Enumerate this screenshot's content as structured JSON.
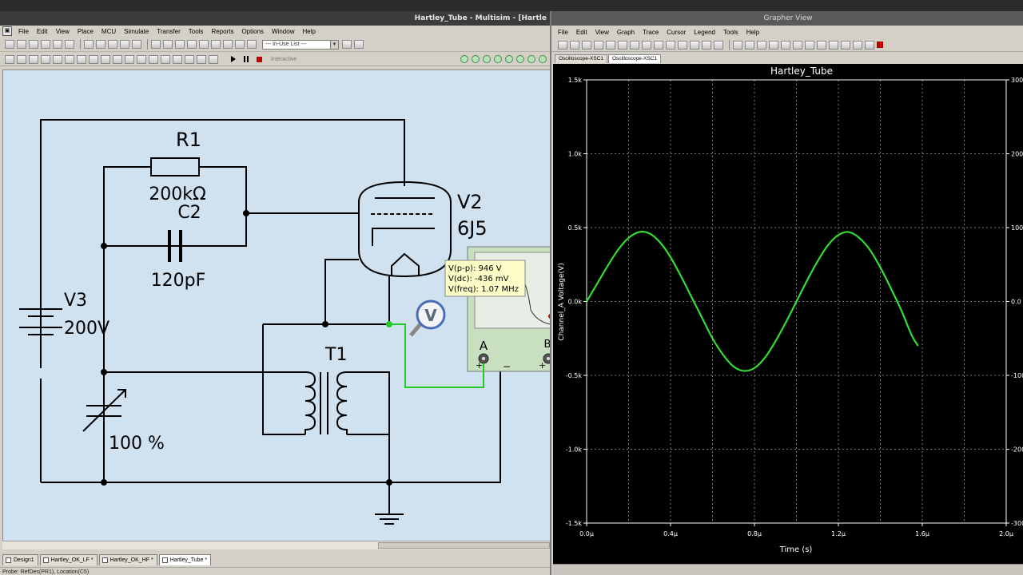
{
  "multisim": {
    "title": "Hartley_Tube - Multisim - [Hartle",
    "app_icon": "multisim-icon",
    "menu": [
      "File",
      "Edit",
      "View",
      "Place",
      "MCU",
      "Simulate",
      "Transfer",
      "Tools",
      "Reports",
      "Options",
      "Window",
      "Help"
    ],
    "in_use_list": "--- In-Use List ---",
    "interactive_label": "Interactive",
    "circuit": {
      "r1_name": "R1",
      "r1_value": "200kΩ",
      "c2_name": "C2",
      "c2_value": "120pF",
      "v2_name": "V2",
      "v2_model": "6J5",
      "v3_name": "V3",
      "v3_value": "200V",
      "t1_name": "T1",
      "pot_value": "100 %",
      "probe_label": "V",
      "scope_a": "A",
      "scope_b": "B",
      "plus": "+",
      "minus": "−",
      "probe_readout": {
        "vpp": "V(p-p):  946 V",
        "vdc": "V(dc):  -436 mV",
        "vfreq": "V(freq):  1.07 MHz"
      }
    },
    "tabs": [
      "Design1",
      "Hartley_OK_LF *",
      "Hartley_OK_HF *",
      "Hartley_Tube *"
    ],
    "active_tab": "Hartley_Tube *",
    "status": "Probe: RefDes(PR1), Location(C5)"
  },
  "grapher": {
    "title": "Grapher View",
    "menu": [
      "File",
      "Edit",
      "View",
      "Graph",
      "Trace",
      "Cursor",
      "Legend",
      "Tools",
      "Help"
    ],
    "tabs": [
      "Oscilloscope-XSC1",
      "Oscilloscope-XSC1"
    ],
    "active_tab_index": 1,
    "trace_color": "#33dd33",
    "chart_data": {
      "type": "line",
      "title": "Hartley_Tube",
      "xlabel": "Time (s)",
      "ylabel": "Channel_A Voltage(V)",
      "xlim": [
        0,
        2.0
      ],
      "ylim": [
        -1.5,
        1.5
      ],
      "x_ticks": [
        "0.0μ",
        "0.4μ",
        "0.8μ",
        "1.2μ",
        "1.6μ",
        "2.0μ"
      ],
      "y_ticks": [
        "1.5k",
        "1.0k",
        "0.5k",
        "0.0k",
        "-0.5k",
        "-1.0k",
        "-1.5k"
      ],
      "y2_ticks": [
        "300",
        "200",
        "100",
        "0.0",
        "-100",
        "-200",
        "-300"
      ],
      "grid": true,
      "series": [
        {
          "x": [
            0.0,
            0.05,
            0.1,
            0.15,
            0.2,
            0.25,
            0.3,
            0.35,
            0.4,
            0.45,
            0.5,
            0.55,
            0.6,
            0.65,
            0.7,
            0.75,
            0.8,
            0.85,
            0.9,
            0.95,
            1.0,
            1.05,
            1.1,
            1.15,
            1.2,
            1.25,
            1.3,
            1.35,
            1.4,
            1.45,
            1.5,
            1.55,
            1.58
          ],
          "y": [
            0.0,
            0.12,
            0.24,
            0.35,
            0.43,
            0.47,
            0.46,
            0.4,
            0.3,
            0.17,
            0.03,
            -0.11,
            -0.25,
            -0.36,
            -0.44,
            -0.47,
            -0.45,
            -0.38,
            -0.27,
            -0.14,
            0.0,
            0.14,
            0.27,
            0.38,
            0.45,
            0.47,
            0.43,
            0.35,
            0.23,
            0.09,
            -0.06,
            -0.23,
            -0.3
          ]
        }
      ]
    }
  }
}
